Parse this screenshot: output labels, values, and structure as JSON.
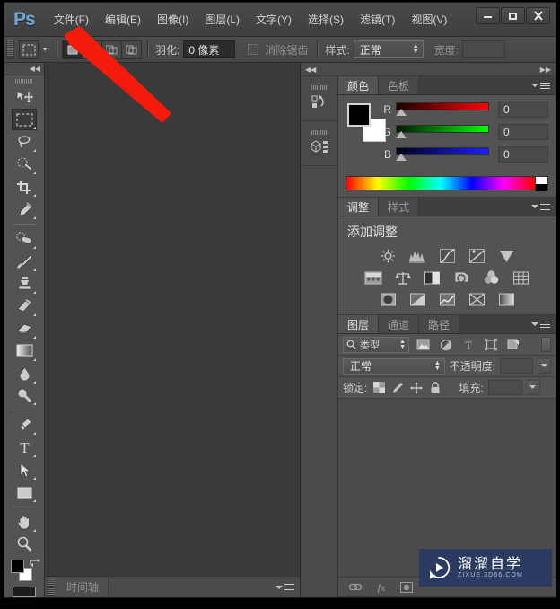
{
  "app": {
    "logo": "Ps",
    "menus": [
      {
        "label": "文件(F)"
      },
      {
        "label": "编辑(E)"
      },
      {
        "label": "图像(I)"
      },
      {
        "label": "图层(L)"
      },
      {
        "label": "文字(Y)"
      },
      {
        "label": "选择(S)"
      },
      {
        "label": "滤镜(T)"
      },
      {
        "label": "视图(V)"
      }
    ],
    "window_buttons": [
      {
        "name": "minimize",
        "glyph": "—"
      },
      {
        "name": "maximize",
        "glyph": "▫"
      },
      {
        "name": "close",
        "glyph": "✕"
      }
    ]
  },
  "options_bar": {
    "tool_icon": "rectangular-marquee-icon",
    "selection_modes": [
      {
        "name": "new-selection",
        "active": true
      },
      {
        "name": "add-to-selection",
        "active": false
      },
      {
        "name": "subtract-from-selection",
        "active": false
      },
      {
        "name": "intersect-selection",
        "active": false
      }
    ],
    "feather_label": "羽化:",
    "feather_value": "0 像素",
    "antialias_label": "消除锯齿",
    "antialias_checked": false,
    "style_label": "样式:",
    "style_value": "正常",
    "width_label": "宽度:",
    "width_value": ""
  },
  "toolbox": {
    "tools": [
      {
        "name": "move-tool",
        "selected": false,
        "has_flyout": false
      },
      {
        "name": "rectangular-marquee-tool",
        "selected": true,
        "has_flyout": true
      },
      {
        "name": "lasso-tool",
        "selected": false,
        "has_flyout": true
      },
      {
        "name": "quick-selection-tool",
        "selected": false,
        "has_flyout": true
      },
      {
        "name": "crop-tool",
        "selected": false,
        "has_flyout": true
      },
      {
        "name": "eyedropper-tool",
        "selected": false,
        "has_flyout": true
      },
      {
        "name": "spot-healing-brush-tool",
        "selected": false,
        "has_flyout": true
      },
      {
        "name": "brush-tool",
        "selected": false,
        "has_flyout": true
      },
      {
        "name": "clone-stamp-tool",
        "selected": false,
        "has_flyout": true
      },
      {
        "name": "history-brush-tool",
        "selected": false,
        "has_flyout": true
      },
      {
        "name": "eraser-tool",
        "selected": false,
        "has_flyout": true
      },
      {
        "name": "gradient-tool",
        "selected": false,
        "has_flyout": true
      },
      {
        "name": "blur-tool",
        "selected": false,
        "has_flyout": true
      },
      {
        "name": "dodge-tool",
        "selected": false,
        "has_flyout": true
      },
      {
        "name": "pen-tool",
        "selected": false,
        "has_flyout": true
      },
      {
        "name": "type-tool",
        "selected": false,
        "has_flyout": true
      },
      {
        "name": "path-selection-tool",
        "selected": false,
        "has_flyout": true
      },
      {
        "name": "rectangle-tool",
        "selected": false,
        "has_flyout": true
      },
      {
        "name": "hand-tool",
        "selected": false,
        "has_flyout": true
      },
      {
        "name": "zoom-tool",
        "selected": false,
        "has_flyout": false
      }
    ],
    "foreground_color": "#000000",
    "background_color": "#ffffff"
  },
  "timeline": {
    "tab_label": "时间轴"
  },
  "icon_rail": [
    {
      "name": "history-panel-icon"
    },
    {
      "name": "3d-panel-icon"
    }
  ],
  "color_panel": {
    "tabs": [
      {
        "label": "颜色",
        "active": true
      },
      {
        "label": "色板",
        "active": false
      }
    ],
    "foreground_color": "#000000",
    "background_color": "#ffffff",
    "channels": [
      {
        "letter": "R",
        "value": "0"
      },
      {
        "letter": "G",
        "value": "0"
      },
      {
        "letter": "B",
        "value": "0"
      }
    ]
  },
  "adjustments_panel": {
    "tabs": [
      {
        "label": "调整",
        "active": true
      },
      {
        "label": "样式",
        "active": false
      }
    ],
    "title": "添加调整",
    "rows": [
      [
        {
          "name": "brightness-contrast-icon"
        },
        {
          "name": "levels-icon"
        },
        {
          "name": "curves-icon"
        },
        {
          "name": "exposure-icon"
        },
        {
          "name": "vibrance-icon"
        }
      ],
      [
        {
          "name": "hue-saturation-icon"
        },
        {
          "name": "color-balance-icon"
        },
        {
          "name": "black-white-icon"
        },
        {
          "name": "photo-filter-icon"
        },
        {
          "name": "channel-mixer-icon"
        },
        {
          "name": "color-lookup-icon"
        }
      ],
      [
        {
          "name": "invert-icon"
        },
        {
          "name": "posterize-icon"
        },
        {
          "name": "threshold-icon"
        },
        {
          "name": "selective-color-icon"
        },
        {
          "name": "gradient-map-icon"
        }
      ]
    ]
  },
  "layers_panel": {
    "tabs": [
      {
        "label": "图层",
        "active": true
      },
      {
        "label": "通道",
        "active": false
      },
      {
        "label": "路径",
        "active": false
      }
    ],
    "filter_label": "类型",
    "filter_icons": [
      {
        "name": "filter-pixel-icon"
      },
      {
        "name": "filter-adjustment-icon"
      },
      {
        "name": "filter-type-icon"
      },
      {
        "name": "filter-shape-icon"
      },
      {
        "name": "filter-smart-object-icon"
      }
    ],
    "blend_mode": "正常",
    "opacity_label": "不透明度:",
    "opacity_value": "",
    "lock_label": "锁定:",
    "lock_icons": [
      {
        "name": "lock-transparent-pixels-icon"
      },
      {
        "name": "lock-image-pixels-icon"
      },
      {
        "name": "lock-position-icon"
      },
      {
        "name": "lock-all-icon"
      }
    ],
    "fill_label": "填充:",
    "fill_value": "",
    "bottom_icons": [
      {
        "name": "link-layers-icon"
      },
      {
        "name": "layer-style-fx-icon"
      },
      {
        "name": "add-layer-mask-icon"
      }
    ]
  },
  "watermark": {
    "title": "溜溜自学",
    "subtitle": "ZIXUE.3D66.COM",
    "icon": "play-badge-icon",
    "background": "#2b3a60"
  },
  "annotation": {
    "arrow_color": "#f41b0d",
    "name": "pointer-arrow-to-file-menu"
  }
}
